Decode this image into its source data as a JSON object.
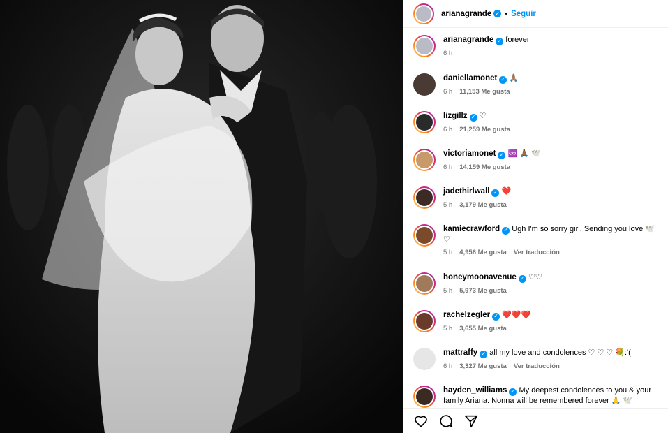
{
  "header": {
    "username": "arianagrande",
    "dot": "•",
    "follow_label": "Seguir"
  },
  "comments": [
    {
      "username": "arianagrande",
      "text": "forever",
      "time": "6 h",
      "likes": "",
      "translate": "",
      "avatar_color": "#b9bcc4",
      "ring": true
    },
    {
      "username": "daniellamonet",
      "text": "🙏🏽",
      "time": "6 h",
      "likes": "11,153 Me gusta",
      "translate": "",
      "avatar_color": "#4a3a34",
      "ring": false
    },
    {
      "username": "lizgillz",
      "text": "♡",
      "time": "6 h",
      "likes": "21,259 Me gusta",
      "translate": "",
      "avatar_color": "#2a2a2a",
      "ring": true
    },
    {
      "username": "victoriamonet",
      "text": "♾️ 🙏🏾 🕊️",
      "time": "6 h",
      "likes": "14,159 Me gusta",
      "translate": "",
      "avatar_color": "#c89a6a",
      "ring": true
    },
    {
      "username": "jadethirlwall",
      "text": "❤️",
      "time": "5 h",
      "likes": "3,179 Me gusta",
      "translate": "",
      "avatar_color": "#3b2b24",
      "ring": true
    },
    {
      "username": "kamiecrawford",
      "text": "Ugh I'm so sorry girl. Sending you love 🕊️ ♡",
      "time": "5 h",
      "likes": "4,956 Me gusta",
      "translate": "Ver traducción",
      "avatar_color": "#7a4a2a",
      "ring": true
    },
    {
      "username": "honeymoonavenue",
      "text": "♡♡",
      "time": "5 h",
      "likes": "5,973 Me gusta",
      "translate": "",
      "avatar_color": "#a07a5a",
      "ring": true
    },
    {
      "username": "rachelzegler",
      "text": "❤️❤️❤️",
      "time": "5 h",
      "likes": "3,655 Me gusta",
      "translate": "",
      "avatar_color": "#6a3a2a",
      "ring": true
    },
    {
      "username": "mattraffy",
      "text": "all my love and condolences ♡ ♡ ♡ 💐:'(",
      "time": "6 h",
      "likes": "3,327 Me gusta",
      "translate": "Ver traducción",
      "avatar_color": "#e6e6e6",
      "ring": false
    },
    {
      "username": "hayden_williams",
      "text": "My deepest condolences to you & your family Ariana. Nonna will be remembered forever 🙏 🕊️",
      "time": "",
      "likes": "",
      "translate": "",
      "avatar_color": "#3a2a22",
      "ring": true
    }
  ],
  "actions": {
    "like_icon": "heart-icon",
    "comment_icon": "comment-icon",
    "share_icon": "share-icon"
  },
  "colors": {
    "accent": "#0095f6",
    "meta": "#737373"
  }
}
